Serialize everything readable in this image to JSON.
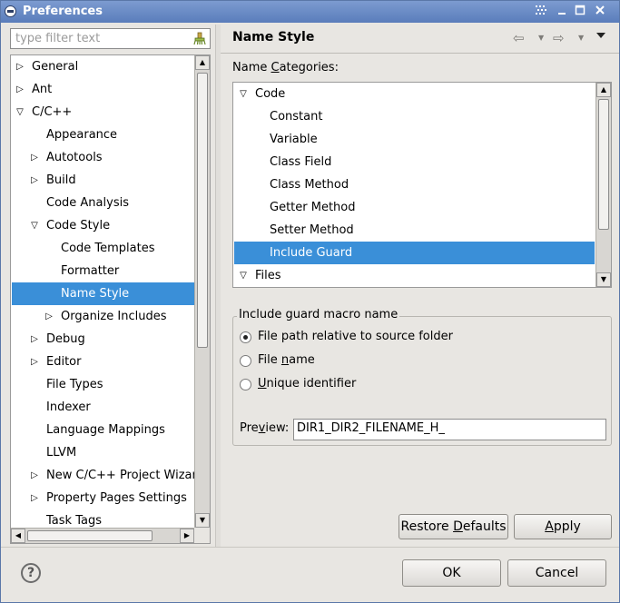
{
  "window": {
    "title": "Preferences"
  },
  "filter": {
    "placeholder": "type filter text"
  },
  "tree": {
    "items": [
      {
        "label": "General",
        "twisty": "▷",
        "indent": 0
      },
      {
        "label": "Ant",
        "twisty": "▷",
        "indent": 0
      },
      {
        "label": "C/C++",
        "twisty": "▽",
        "indent": 0
      },
      {
        "label": "Appearance",
        "twisty": "",
        "indent": 1
      },
      {
        "label": "Autotools",
        "twisty": "▷",
        "indent": 1
      },
      {
        "label": "Build",
        "twisty": "▷",
        "indent": 1
      },
      {
        "label": "Code Analysis",
        "twisty": "",
        "indent": 1
      },
      {
        "label": "Code Style",
        "twisty": "▽",
        "indent": 1
      },
      {
        "label": "Code Templates",
        "twisty": "",
        "indent": 2
      },
      {
        "label": "Formatter",
        "twisty": "",
        "indent": 2
      },
      {
        "label": "Name Style",
        "twisty": "",
        "indent": 2,
        "selected": true
      },
      {
        "label": "Organize Includes",
        "twisty": "▷",
        "indent": 2
      },
      {
        "label": "Debug",
        "twisty": "▷",
        "indent": 1
      },
      {
        "label": "Editor",
        "twisty": "▷",
        "indent": 1
      },
      {
        "label": "File Types",
        "twisty": "",
        "indent": 1
      },
      {
        "label": "Indexer",
        "twisty": "",
        "indent": 1
      },
      {
        "label": "Language Mappings",
        "twisty": "",
        "indent": 1
      },
      {
        "label": "LLVM",
        "twisty": "",
        "indent": 1
      },
      {
        "label": "New C/C++ Project Wizard",
        "twisty": "▷",
        "indent": 1
      },
      {
        "label": "Property Pages Settings",
        "twisty": "▷",
        "indent": 1
      },
      {
        "label": "Task Tags",
        "twisty": "",
        "indent": 1
      }
    ]
  },
  "page": {
    "title": "Name Style",
    "categories_label_pre": "Name ",
    "categories_label_mn": "C",
    "categories_label_post": "ategories:"
  },
  "categories": {
    "items": [
      {
        "label": "Code",
        "twisty": "▽",
        "indent": 0
      },
      {
        "label": "Constant",
        "twisty": "",
        "indent": 1
      },
      {
        "label": "Variable",
        "twisty": "",
        "indent": 1
      },
      {
        "label": "Class Field",
        "twisty": "",
        "indent": 1
      },
      {
        "label": "Class Method",
        "twisty": "",
        "indent": 1
      },
      {
        "label": "Getter Method",
        "twisty": "",
        "indent": 1
      },
      {
        "label": "Setter Method",
        "twisty": "",
        "indent": 1
      },
      {
        "label": "Include Guard",
        "twisty": "",
        "indent": 1,
        "selected": true
      },
      {
        "label": "Files",
        "twisty": "▽",
        "indent": 0
      }
    ]
  },
  "guard": {
    "group_title": "Include guard macro name",
    "option1": "File path relative to source folder",
    "option2_pre": "File ",
    "option2_mn": "n",
    "option2_post": "ame",
    "option3_mn": "U",
    "option3_post": "nique identifier",
    "preview_pre": "Pre",
    "preview_mn": "v",
    "preview_post": "iew:",
    "preview_value": "DIR1_DIR2_FILENAME_H_"
  },
  "buttons": {
    "restore_pre": "Restore ",
    "restore_mn": "D",
    "restore_post": "efaults",
    "apply_mn": "A",
    "apply_post": "pply",
    "ok": "OK",
    "cancel": "Cancel",
    "help": "?"
  },
  "icons": {
    "window": "app-icon",
    "clear": "clear-filter-icon",
    "back": "back-arrow-icon",
    "forward": "forward-arrow-icon",
    "menu": "view-menu-icon",
    "help": "help-icon"
  },
  "colors": {
    "selection": "#3a8fd8",
    "titlebar": "#5a7dbb"
  }
}
